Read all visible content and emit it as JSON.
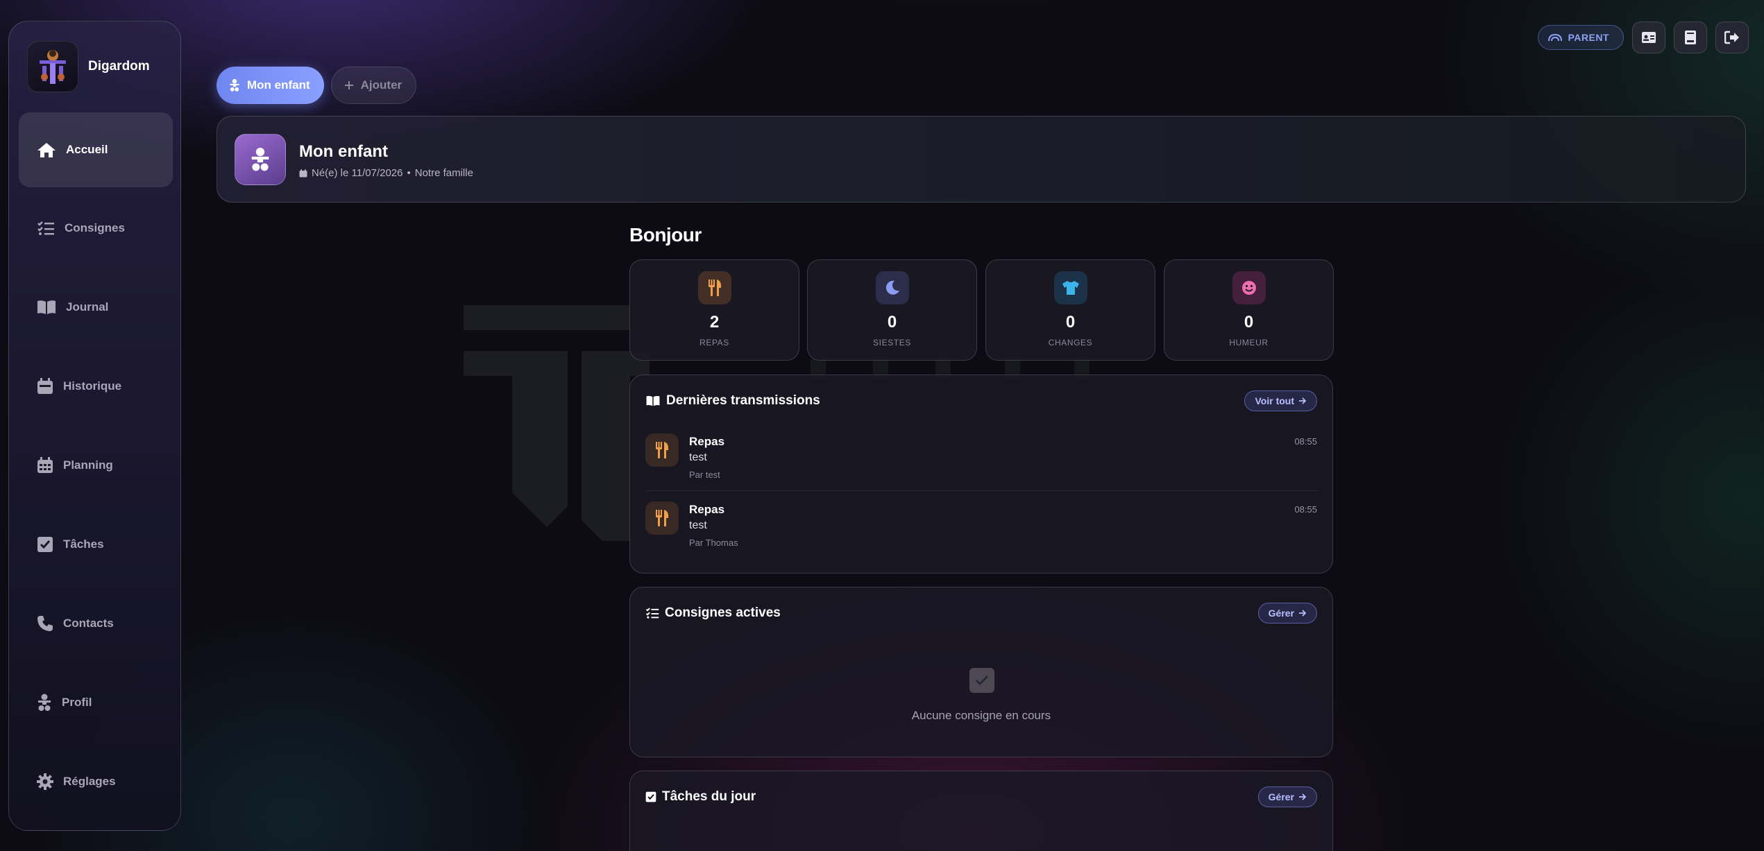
{
  "brand": {
    "name": "Digardom"
  },
  "sidebar": {
    "items": [
      {
        "label": "Accueil",
        "icon": "home-icon",
        "active": true
      },
      {
        "label": "Consignes",
        "icon": "list-check-icon"
      },
      {
        "label": "Journal",
        "icon": "book-icon"
      },
      {
        "label": "Historique",
        "icon": "calendar-icon"
      },
      {
        "label": "Planning",
        "icon": "calendar-grid-icon"
      },
      {
        "label": "Tâches",
        "icon": "checkbox-icon"
      },
      {
        "label": "Contacts",
        "icon": "phone-icon"
      },
      {
        "label": "Profil",
        "icon": "child-icon"
      },
      {
        "label": "Réglages",
        "icon": "gear-icon"
      }
    ]
  },
  "topbar": {
    "role_badge": "PARENT",
    "icons": [
      "id-card-icon",
      "notebook-icon",
      "logout-icon"
    ]
  },
  "child_tabs": [
    {
      "label": "Mon enfant",
      "active": true
    },
    {
      "label": "Ajouter"
    }
  ],
  "child": {
    "name": "Mon enfant",
    "birth": "Né(e) le 11/07/2026",
    "family": "Notre famille"
  },
  "greeting": "Bonjour",
  "stats": [
    {
      "value": "2",
      "label": "REPAS",
      "icon": "utensils-icon",
      "color": "#f0a04a"
    },
    {
      "value": "0",
      "label": "SIESTES",
      "icon": "moon-icon",
      "color": "#8c9cf2"
    },
    {
      "value": "0",
      "label": "CHANGES",
      "icon": "shirt-icon",
      "color": "#3bb4ec"
    },
    {
      "value": "0",
      "label": "HUMEUR",
      "icon": "smile-icon",
      "color": "#ec6fb4"
    }
  ],
  "transmissions": {
    "title": "Dernières transmissions",
    "action": "Voir tout",
    "entries": [
      {
        "title": "Repas",
        "text": "test",
        "by": "Par test",
        "time": "08:55"
      },
      {
        "title": "Repas",
        "text": "test",
        "by": "Par Thomas",
        "time": "08:55"
      }
    ]
  },
  "consignes": {
    "title": "Consignes actives",
    "action": "Gérer",
    "empty": "Aucune consigne en cours"
  },
  "taches": {
    "title": "Tâches du jour",
    "action": "Gérer"
  },
  "colors": {
    "accent": "#7c8ff4",
    "background": "#0d0c14",
    "meal": "#f0a04a"
  }
}
